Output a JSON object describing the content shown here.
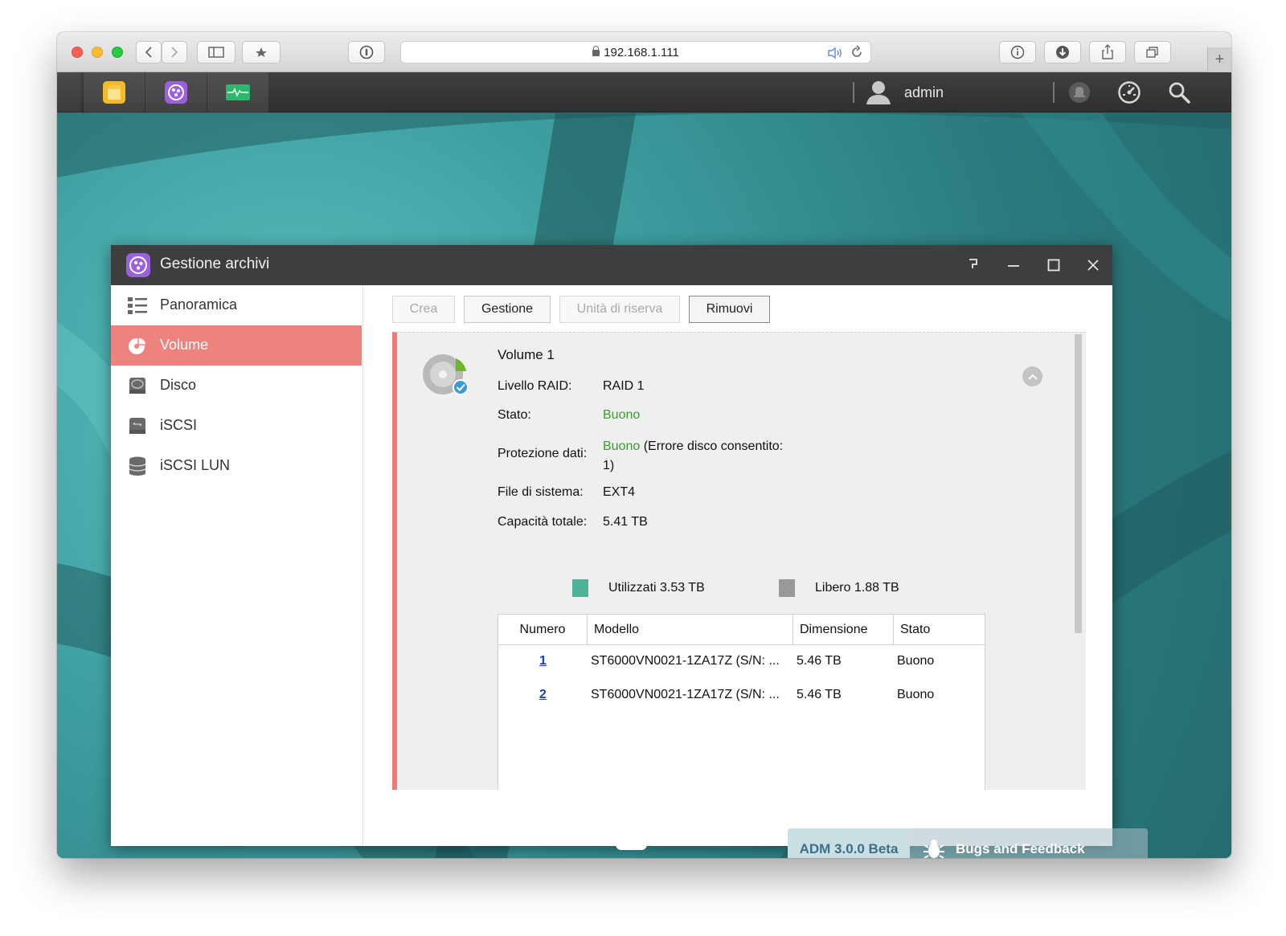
{
  "browser": {
    "url": "192.168.1.111"
  },
  "adm_bar": {
    "user": "admin",
    "apps": [
      "file-explorer-icon",
      "storage-manager-icon",
      "app-central-icon"
    ]
  },
  "window": {
    "title": "Gestione archivi"
  },
  "sidebar": {
    "items": [
      {
        "label": "Panoramica",
        "icon": "list-icon"
      },
      {
        "label": "Volume",
        "icon": "volume-icon",
        "active": true
      },
      {
        "label": "Disco",
        "icon": "disk-icon"
      },
      {
        "label": "iSCSI",
        "icon": "iscsi-icon"
      },
      {
        "label": "iSCSI LUN",
        "icon": "database-icon"
      }
    ]
  },
  "toolbar": {
    "create": "Crea",
    "manage": "Gestione",
    "spare": "Unità di riserva",
    "remove": "Rimuovi"
  },
  "volume": {
    "name": "Volume 1",
    "raid_label": "Livello RAID:",
    "raid_value": "RAID 1",
    "status_label": "Stato:",
    "status_value": "Buono",
    "protection_label": "Protezione dati:",
    "protection_value": "Buono",
    "protection_note_1": "(Errore disco consentito:",
    "protection_note_2": "1)",
    "fs_label": "File di sistema:",
    "fs_value": "EXT4",
    "capacity_label": "Capacità totale:",
    "capacity_value": "5.41 TB",
    "used_label": "Utilizzati 3.53 TB",
    "free_label": "Libero 1.88 TB",
    "used_color": "#4fb39a",
    "free_color": "#999999"
  },
  "disks_table": {
    "headers": [
      "Numero",
      "Modello",
      "Dimensione",
      "Stato"
    ],
    "rows": [
      {
        "number": "1",
        "model": "ST6000VN0021-1ZA17Z (S/N: ...",
        "size": "5.46 TB",
        "status": "Buono"
      },
      {
        "number": "2",
        "model": "ST6000VN0021-1ZA17Z (S/N: ...",
        "size": "5.46 TB",
        "status": "Buono"
      }
    ]
  },
  "footer": {
    "version": "ADM 3.0.0 Beta",
    "feedback": "Bugs and Feedback"
  },
  "colors": {
    "accent": "#ee827c",
    "good": "#3e9a32"
  }
}
